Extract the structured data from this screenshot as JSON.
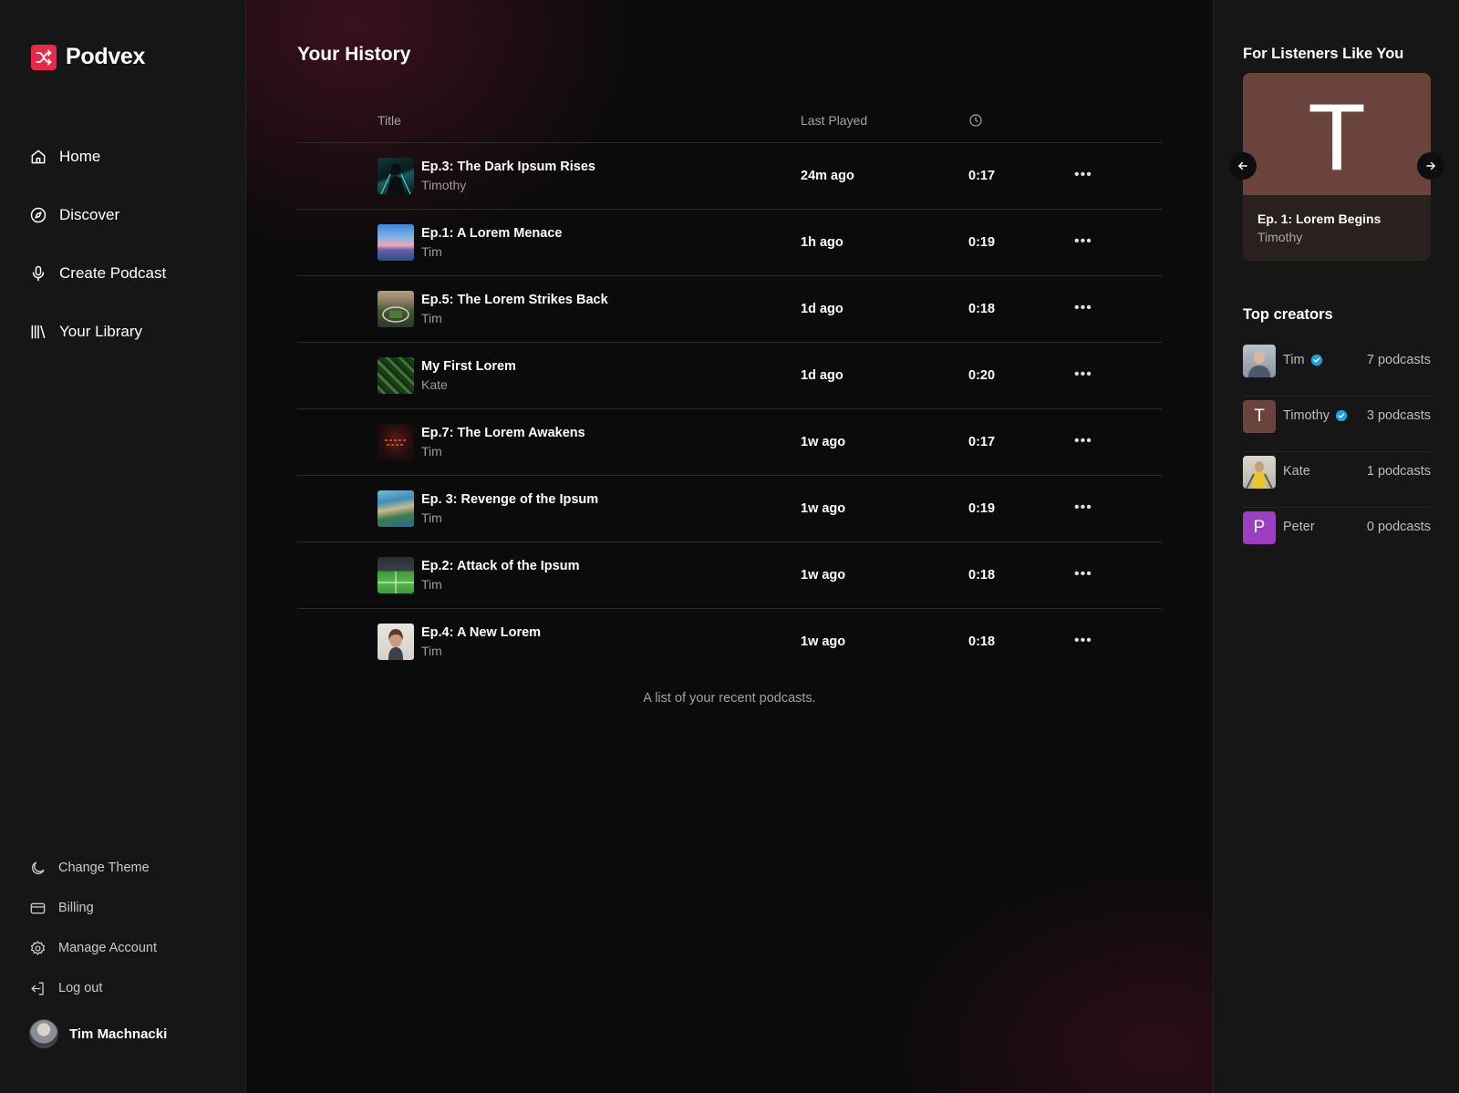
{
  "brand": {
    "name": "Podvex",
    "color": "#e8294a"
  },
  "nav": [
    {
      "label": "Home",
      "icon": "home-icon"
    },
    {
      "label": "Discover",
      "icon": "compass-icon"
    },
    {
      "label": "Create Podcast",
      "icon": "microphone-icon"
    },
    {
      "label": "Your Library",
      "icon": "library-icon"
    }
  ],
  "bottom_nav": [
    {
      "label": "Change Theme",
      "icon": "moon-icon"
    },
    {
      "label": "Billing",
      "icon": "credit-card-icon"
    },
    {
      "label": "Manage Account",
      "icon": "gear-icon"
    },
    {
      "label": "Log out",
      "icon": "logout-icon"
    }
  ],
  "user": {
    "name": "Tim Machnacki"
  },
  "history": {
    "title": "Your History",
    "columns": {
      "title": "Title",
      "last_played": "Last Played",
      "duration_icon": "clock-icon"
    },
    "rows": [
      {
        "title": "Ep.3: The Dark Ipsum Rises",
        "author": "Timothy",
        "last_played": "24m ago",
        "duration": "0:17",
        "thumb": "teal-figure"
      },
      {
        "title": "Ep.1: A Lorem Menace",
        "author": "Tim",
        "last_played": "1h ago",
        "duration": "0:19",
        "thumb": "sunset-sea"
      },
      {
        "title": "Ep.5: The Lorem Strikes Back",
        "author": "Tim",
        "last_played": "1d ago",
        "duration": "0:18",
        "thumb": "stadium-aerial"
      },
      {
        "title": "My First Lorem",
        "author": "Kate",
        "last_played": "1d ago",
        "duration": "0:20",
        "thumb": "green-leaves"
      },
      {
        "title": "Ep.7: The Lorem Awakens",
        "author": "Tim",
        "last_played": "1w ago",
        "duration": "0:17",
        "thumb": "neon-sign"
      },
      {
        "title": "Ep. 3: Revenge of the Ipsum",
        "author": "Tim",
        "last_played": "1w ago",
        "duration": "0:19",
        "thumb": "coastal-town"
      },
      {
        "title": "Ep.2: Attack of the Ipsum",
        "author": "Tim",
        "last_played": "1w ago",
        "duration": "0:18",
        "thumb": "soccer-field"
      },
      {
        "title": "Ep.4: A New Lorem",
        "author": "Tim",
        "last_played": "1w ago",
        "duration": "0:18",
        "thumb": "portrait"
      }
    ],
    "caption": "A list of your recent podcasts."
  },
  "recommend": {
    "title": "For Listeners Like You",
    "card": {
      "letter": "T",
      "title": "Ep. 1: Lorem Begins",
      "author": "Timothy",
      "cover_color": "#6a443c"
    }
  },
  "creators": {
    "title": "Top creators",
    "items": [
      {
        "name": "Tim",
        "verified": true,
        "count": "7 podcasts",
        "avatar_letter": "",
        "avatar_color": "#7a8088"
      },
      {
        "name": "Timothy",
        "verified": true,
        "count": "3 podcasts",
        "avatar_letter": "T",
        "avatar_color": "#6a443c"
      },
      {
        "name": "Kate",
        "verified": false,
        "count": "1 podcasts",
        "avatar_letter": "",
        "avatar_color": "#c9c6b8"
      },
      {
        "name": "Peter",
        "verified": false,
        "count": "0 podcasts",
        "avatar_letter": "P",
        "avatar_color": "#9b3fc0"
      }
    ]
  }
}
